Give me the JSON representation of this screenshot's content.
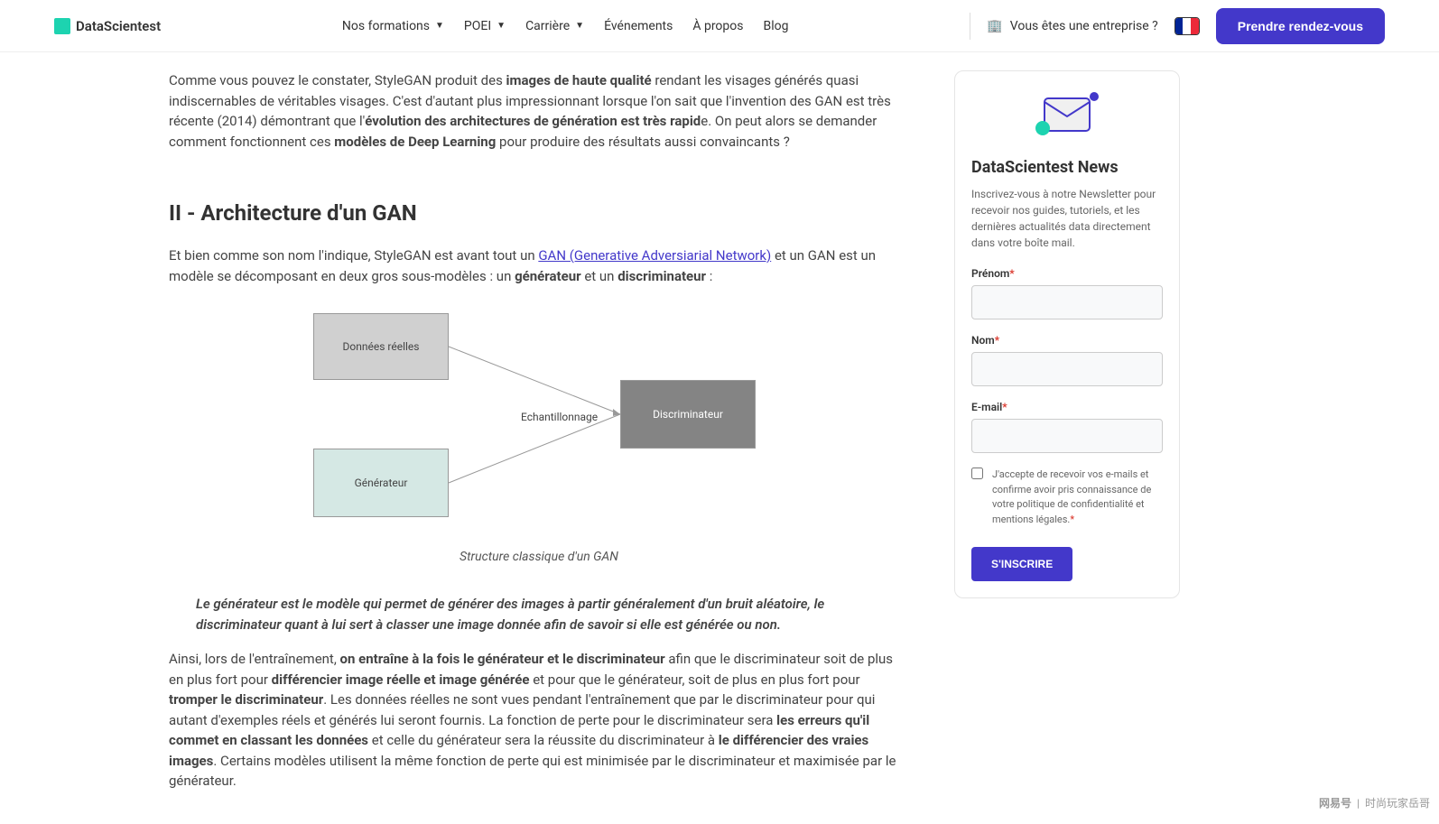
{
  "header": {
    "brand": "DataScientest",
    "nav": {
      "formations": "Nos formations",
      "poei": "POEI",
      "carriere": "Carrière",
      "evenements": "Événements",
      "apropos": "À propos",
      "blog": "Blog"
    },
    "enterprise": "Vous êtes une entreprise ?",
    "cta": "Prendre rendez-vous"
  },
  "article": {
    "p1a": "Comme vous pouvez le constater, StyleGAN produit des ",
    "p1b": "images de haute qualité",
    "p1c": " rendant les visages générés quasi indiscernables de véritables visages. C'est d'autant plus impressionnant lorsque l'on sait que l'invention des GAN est très récente (2014) démontrant que l'",
    "p1d": "évolution des architectures de génération est très rapid",
    "p1e": "e. On peut alors se demander comment fonctionnent ces ",
    "p1f": "modèles de Deep Learning",
    "p1g": " pour produire des résultats aussi convaincants ?",
    "h2": "II - Architecture d'un GAN",
    "p2a": "Et bien comme son nom l'indique, StyleGAN est avant tout un ",
    "p2link": "GAN (Generative Adversiarial Network)",
    "p2b": " et un GAN est un modèle se décomposant en deux gros sous-modèles : un ",
    "p2c": "générateur",
    "p2d": " et un ",
    "p2e": "discriminateur",
    "p2f": " :",
    "diagram": {
      "box1": "Données réelles",
      "box2": "Générateur",
      "box3": "Discriminateur",
      "label": "Echantillonnage"
    },
    "caption": "Structure classique d'un GAN",
    "quote": "Le générateur est le modèle qui permet de générer des images à partir généralement d'un bruit aléatoire, le discriminateur quant à lui sert à classer une image donnée afin de savoir si elle est générée ou non.",
    "p3a": "Ainsi, lors de l'entraînement, ",
    "p3b": "on entraîne à la fois le générateur et le discriminateur",
    "p3c": " afin que le discriminateur soit de plus en plus fort pour ",
    "p3d": "différencier image réelle et image générée",
    "p3e": " et pour que le générateur, soit de plus en plus fort pour ",
    "p3f": "tromper le discriminateur",
    "p3g": ". Les données réelles ne sont vues pendant l'entraînement que par le discriminateur pour qui autant d'exemples réels et générés lui seront fournis. La fonction de perte pour le discriminateur sera ",
    "p3h": "les erreurs qu'il commet en classant les données",
    "p3i": " et celle du générateur sera la réussite du discriminateur à ",
    "p3j": "le différencier des vraies images",
    "p3k": ". Certains modèles utilisent la même fonction de perte qui est minimisée par le discriminateur et maximisée par le générateur."
  },
  "sidebar": {
    "title": "DataScientest News",
    "desc": "Inscrivez-vous à notre Newsletter pour recevoir nos guides, tutoriels, et les dernières actualités data directement dans votre boîte mail.",
    "prenom": "Prénom",
    "nom": "Nom",
    "email": "E-mail",
    "checkbox": "J'accepte de recevoir vos e-mails et confirme avoir pris connaissance de votre politique de confidentialité et mentions légales.",
    "submit": "S'inscrire"
  },
  "watermark": {
    "brand": "网易号",
    "author": "时尚玩家岳哥"
  }
}
